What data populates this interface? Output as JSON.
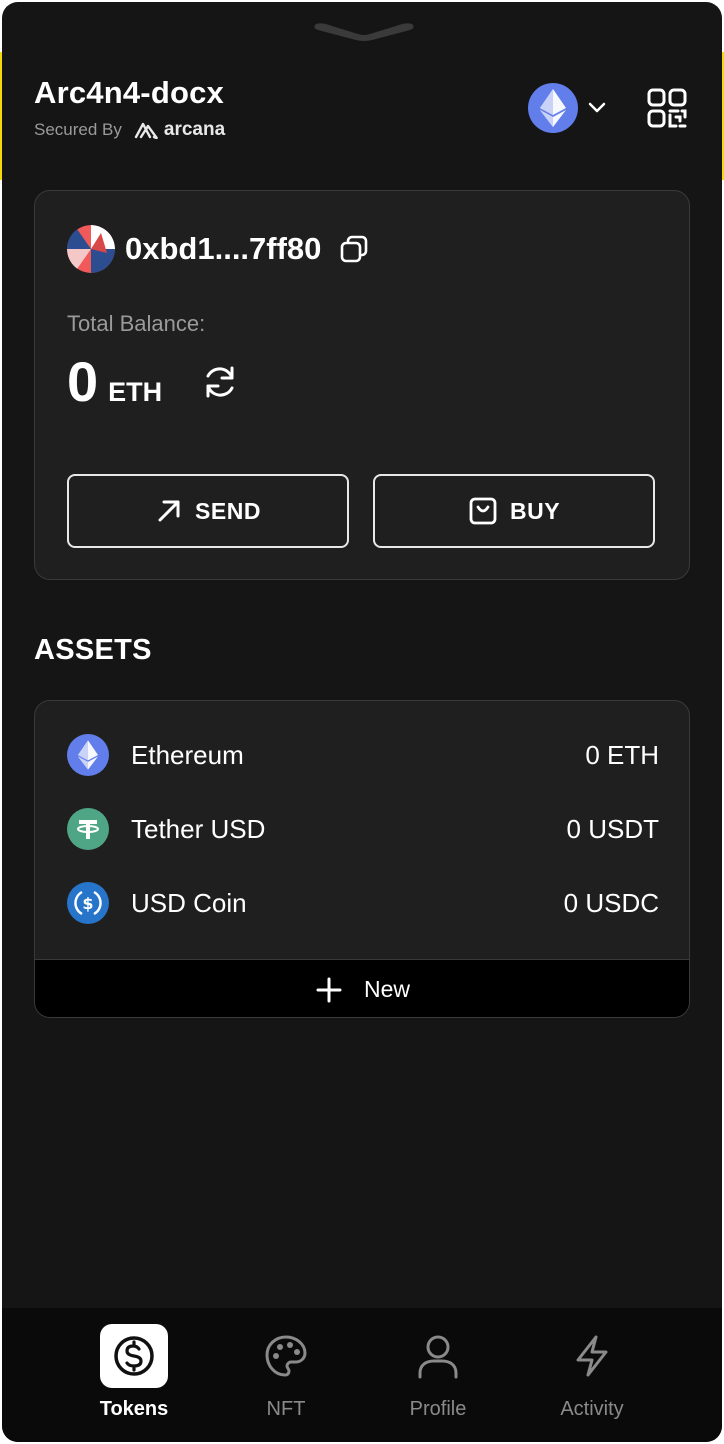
{
  "app": {
    "name": "Arc4n4-docx",
    "secured_by": "Secured By",
    "brand": "arcana"
  },
  "header": {
    "network_icon": "ethereum-icon",
    "qr_icon": "qr-code-icon"
  },
  "account": {
    "address": "0xbd1....7ff80",
    "balance_label": "Total Balance:",
    "balance_amount": "0",
    "balance_unit": "ETH",
    "send_label": "SEND",
    "buy_label": "BUY"
  },
  "assets": {
    "heading": "ASSETS",
    "items": [
      {
        "name": "Ethereum",
        "balance": "0 ETH",
        "icon": "ethereum-icon",
        "color": "#627eea"
      },
      {
        "name": "Tether USD",
        "balance": "0 USDT",
        "icon": "tether-icon",
        "color": "#4fa686"
      },
      {
        "name": "USD Coin",
        "balance": "0 USDC",
        "icon": "usdc-icon",
        "color": "#2775ca"
      }
    ],
    "new_label": "New"
  },
  "nav": {
    "items": [
      {
        "label": "Tokens",
        "icon": "dollar-circle-icon",
        "active": true
      },
      {
        "label": "NFT",
        "icon": "palette-icon",
        "active": false
      },
      {
        "label": "Profile",
        "icon": "user-icon",
        "active": false
      },
      {
        "label": "Activity",
        "icon": "lightning-icon",
        "active": false
      }
    ]
  },
  "colors": {
    "background": "#151515",
    "card": "#1f1f1f",
    "border": "#3a3a3a",
    "accent_yellow": "#f5d90a"
  }
}
